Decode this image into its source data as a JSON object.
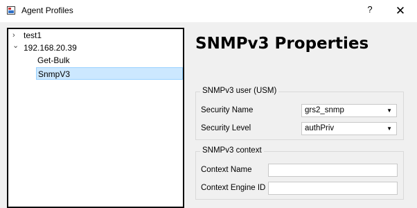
{
  "window": {
    "title": "Agent Profiles",
    "help_glyph": "?",
    "close_glyph": "✕"
  },
  "tree": {
    "items": [
      {
        "label": "test1",
        "expander": "›"
      },
      {
        "label": "192.168.20.39",
        "expander": "⌄"
      },
      {
        "label": "Get-Bulk"
      },
      {
        "label": "SnmpV3"
      }
    ]
  },
  "properties": {
    "heading": "SNMPv3 Properties",
    "usm_group": {
      "title": "SNMPv3 user (USM)",
      "security_name_label": "Security Name",
      "security_name_value": "grs2_snmp",
      "security_level_label": "Security Level",
      "security_level_value": "authPriv"
    },
    "context_group": {
      "title": "SNMPv3 context",
      "context_name_label": "Context Name",
      "context_name_value": "",
      "context_engine_label": "Context Engine ID",
      "context_engine_value": ""
    }
  }
}
